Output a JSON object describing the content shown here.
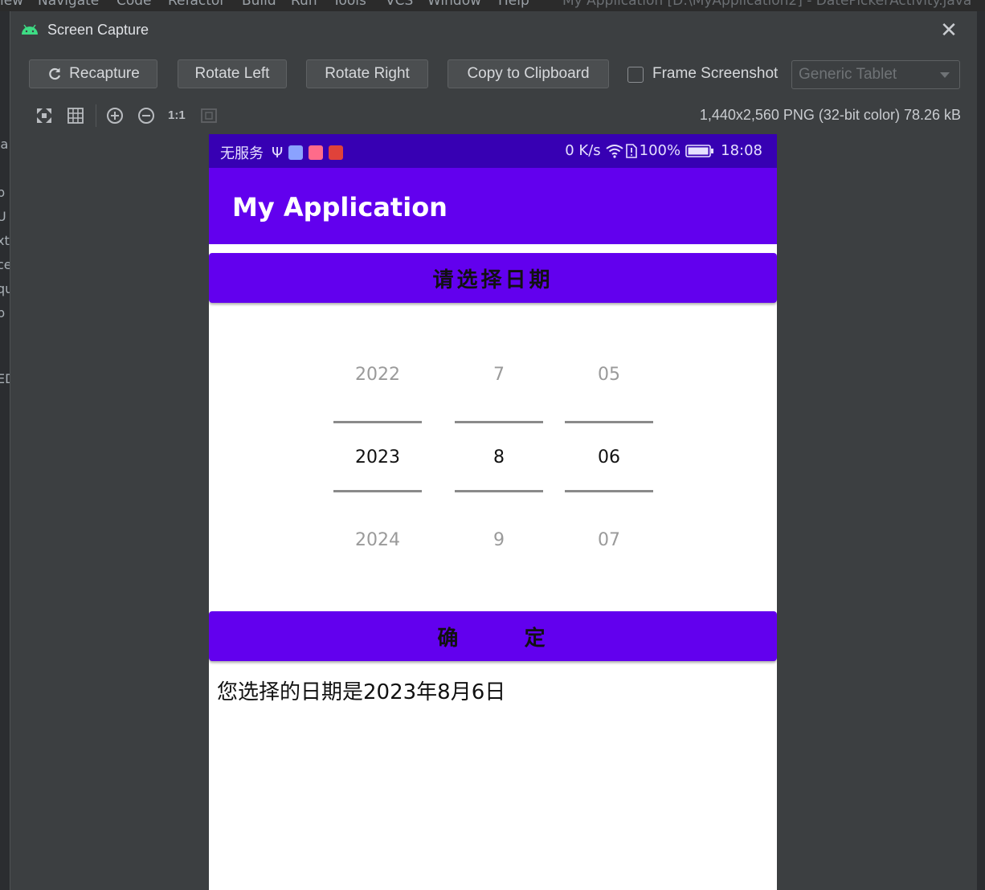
{
  "ide": {
    "menu_items": [
      "iew",
      "Navigate",
      "Code",
      "Refactor",
      "Build",
      "Run",
      "Tools",
      "VCS",
      "Window",
      "Help"
    ],
    "window_title": "My Application [D:\\MyApplication2] - DatePickerActivity.java",
    "left_fragments": [
      "la",
      "p",
      "U",
      "xt",
      "ce",
      "qu",
      "p",
      "ED"
    ]
  },
  "dialog": {
    "title": "Screen Capture",
    "buttons": {
      "recapture": "Recapture",
      "rotate_left": "Rotate Left",
      "rotate_right": "Rotate Right",
      "copy": "Copy to Clipboard"
    },
    "frame_screenshot_label": "Frame Screenshot",
    "frame_screenshot_checked": false,
    "device_select_value": "Generic Tablet",
    "zoom_label": "1:1",
    "image_info": "1,440x2,560 PNG (32-bit color) 78.26 kB"
  },
  "phone": {
    "status": {
      "carrier": "无服务",
      "speed": "0 K/s",
      "battery": "100%",
      "time": "18:08"
    },
    "app_title": "My Application",
    "select_date_button": "请选择日期",
    "picker": {
      "year": {
        "prev": "2022",
        "current": "2023",
        "next": "2024"
      },
      "month": {
        "prev": "7",
        "current": "8",
        "next": "9"
      },
      "day": {
        "prev": "05",
        "current": "06",
        "next": "07"
      }
    },
    "confirm_button": "确      定",
    "result_text": "您选择的日期是2023年8月6日"
  },
  "colors": {
    "status_bar": "#3700b3",
    "primary": "#6200ee",
    "dialog_bg": "#3c3f41"
  }
}
